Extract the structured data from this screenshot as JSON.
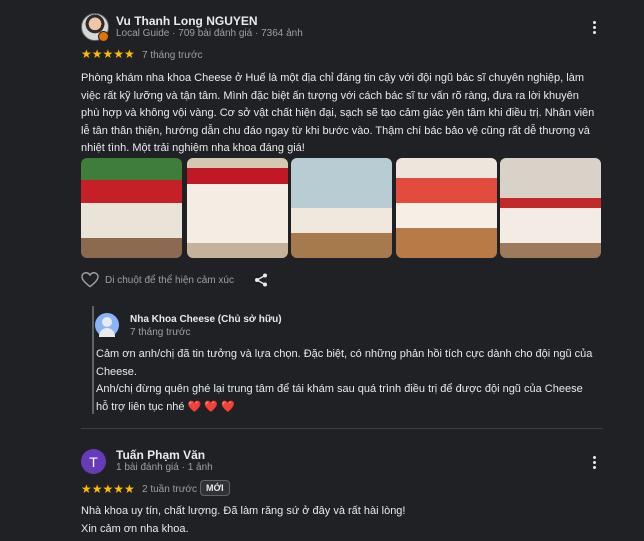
{
  "review1": {
    "author_name": "Vu Thanh Long NGUYEN",
    "author_meta": "Local Guide · 709 bài đánh giá · 7364 ảnh",
    "stars": "★★★★★",
    "time": "7 tháng trước",
    "body_lines": [
      "Phòng khám nha khoa Cheese ở Huế là một địa chỉ đáng tin cậy với đội ngũ bác sĩ chuyên nghiệp, làm",
      "việc rất kỹ lưỡng và tận tâm. Mình đặc biệt ấn tượng với cách bác sĩ tư vấn rõ ràng, đưa ra lời khuyên",
      "phù hợp và không vội vàng. Cơ sở vật chất hiện đại, sạch sẽ tạo cảm giác yên tâm khi điều trị. Nhân viên",
      "lễ tân thân thiện, hướng dẫn chu đáo ngay từ khi bước vào. Thậm chí bác bảo vệ cũng rất dễ thương và",
      "nhiệt tình. Một trải nghiệm nha khoa đáng giá!"
    ],
    "like_hint": "Di chuột để thể hiện cảm xúc"
  },
  "owner_reply": {
    "name": "Nha Khoa Cheese (Chủ sở hữu)",
    "time": "7 tháng trước",
    "lines": [
      "Cảm ơn anh/chị đã tin tưởng và lựa chọn. Đặc biệt, có những phản hồi tích cực dành cho đội ngũ của",
      "Cheese.",
      "Anh/chị đừng quên ghé lại trung tâm để tái khám sau quá trình điều trị để được đội ngũ của Cheese",
      "hỗ trợ liên tục nhé"
    ],
    "hearts": "❤️ ❤️ ❤️"
  },
  "review2": {
    "avatar_letter": "T",
    "author_name": "Tuấn Phạm Văn",
    "author_meta": "1 bài đánh giá · 1 ảnh",
    "stars": "★★★★★",
    "time": "2 tuần trước",
    "badge": "MỚI",
    "body_lines": [
      "Nhà khoa uy tín, chất lượng. Đã làm răng sứ ở đây và rất hài lòng!",
      "Xin cảm ơn nha khoa."
    ]
  },
  "colors": {
    "background": "#202124",
    "star": "#fbbc04",
    "heart": "#ea4335",
    "avatar_t": "#673ab7"
  }
}
